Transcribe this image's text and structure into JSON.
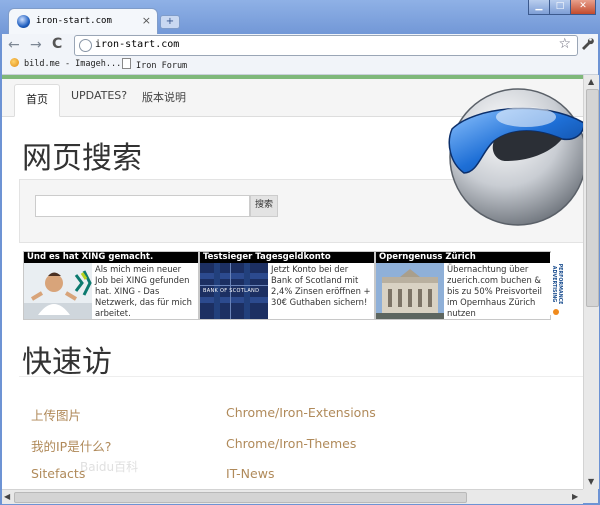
{
  "browser": {
    "tab_title": "iron-start.com",
    "tab_close": "×",
    "new_tab": "+",
    "window_buttons": {
      "minimize": "▁",
      "maximize": "□",
      "close": "✕"
    },
    "back": "←",
    "forward": "→",
    "reload": "C",
    "url": "iron-start.com",
    "star": "☆",
    "wrench": "🔧",
    "bookmarks": [
      {
        "label": "bild.me - Imageh...",
        "icon": "bild-me-favicon"
      },
      {
        "label": "Iron Forum",
        "icon": "page-icon"
      }
    ]
  },
  "page": {
    "nav_tabs": [
      "首页",
      "UPDATES?",
      "版本说明"
    ],
    "search_heading": "网页搜索",
    "search_input_value": "",
    "search_button": "搜索",
    "ads": [
      {
        "title": "Und es hat XING gemacht.",
        "text": "Als mich mein neuer Job bei XING gefunden hat. XING - Das Netzwerk, das für mich arbeitet."
      },
      {
        "title": "Testsieger Tagesgeldkonto",
        "text": "Jetzt Konto bei der Bank of Scotland mit 2,4% Zinsen eröffnen + 30€ Guthaben sichern!",
        "image_text": "BANK OF SCOTLAND"
      },
      {
        "title": "Operngenuss Zürich",
        "text": "Übernachtung über zuerich.com buchen & bis zu 50% Preisvorteil im Opernhaus Zürich nutzen"
      }
    ],
    "ad_badge": "PERFORMANCE ADVERTISING",
    "quick_heading": "快速访",
    "quick_links_left": [
      "上传图片",
      "我的IP是什么?",
      "Sitefacts"
    ],
    "quick_links_right": [
      "Chrome/Iron-Extensions",
      "Chrome/Iron-Themes",
      "IT-News"
    ],
    "watermark": "Baidu百科"
  },
  "colors": {
    "link": "#b08a5a",
    "accent_green": "#7fb87a",
    "chrome_frame": "#6d93d4"
  }
}
